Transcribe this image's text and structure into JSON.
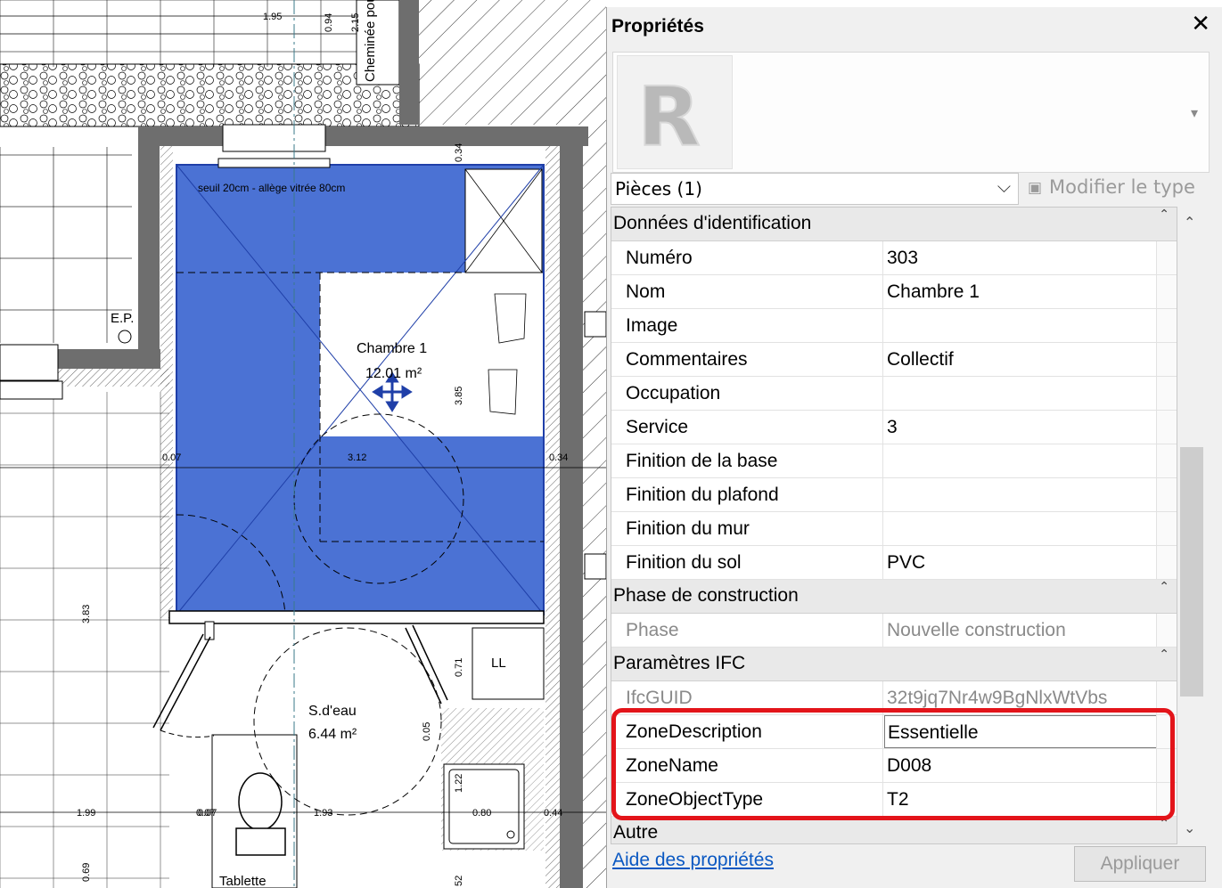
{
  "plan": {
    "room_name": "Chambre 1",
    "room_area": "12.01 m²",
    "room2_name": "S.d'eau",
    "room2_area": "6.44 m²",
    "sill_note": "seuil 20cm - allège vitrée 80cm",
    "ep_label": "E.P.",
    "ll_label": "LL",
    "tablette_label": "Tablette",
    "dims": [
      "1.95",
      "0.94",
      "2.15",
      "0.34",
      "3.85",
      "0.07",
      "3.12",
      "0.34",
      "3.83",
      "0.07",
      "0.71",
      "0.05",
      "1.22",
      "1.99",
      "0.07",
      "1.93",
      "0.80",
      "0.44",
      "0.69",
      "52"
    ],
    "vertical_note": "Cheminée pour ventilation de",
    "colors": {
      "room_fill": "#4b72d4",
      "wall": "#6e6e6e"
    }
  },
  "panel": {
    "title": "Propriétés",
    "close_symbol": "✕",
    "thumb_letter": "R",
    "type_chevron": "▾",
    "selector_label": "Pièces (1)",
    "selector_arrow": "⌵",
    "modify_type_label": "Modifier le type",
    "modify_type_icon": "▣",
    "groups": [
      {
        "label": "Données d'identification",
        "rows": [
          {
            "key": "Numéro",
            "value": "303"
          },
          {
            "key": "Nom",
            "value": "Chambre 1"
          },
          {
            "key": "Image",
            "value": ""
          },
          {
            "key": "Commentaires",
            "value": "Collectif"
          },
          {
            "key": "Occupation",
            "value": ""
          },
          {
            "key": "Service",
            "value": "3"
          },
          {
            "key": "Finition de la base",
            "value": ""
          },
          {
            "key": "Finition du plafond",
            "value": ""
          },
          {
            "key": "Finition du mur",
            "value": ""
          },
          {
            "key": "Finition du sol",
            "value": "PVC"
          }
        ]
      },
      {
        "label": "Phase de construction",
        "rows": [
          {
            "key": "Phase",
            "value": "Nouvelle construction",
            "readonly": true
          }
        ]
      },
      {
        "label": "Paramètres IFC",
        "rows": [
          {
            "key": "IfcGUID",
            "value": "32t9jq7Nr4w9BgNlxWtVbs",
            "readonly": true
          },
          {
            "key": "ZoneDescription",
            "value": "Essentielle",
            "editing": true
          },
          {
            "key": "ZoneName",
            "value": "D008"
          },
          {
            "key": "ZoneObjectType",
            "value": "T2"
          }
        ]
      },
      {
        "label": "Autre",
        "rows": []
      }
    ],
    "collapse_symbol": "⌃",
    "help_link": "Aide des propriétés",
    "apply_button": "Appliquer"
  }
}
